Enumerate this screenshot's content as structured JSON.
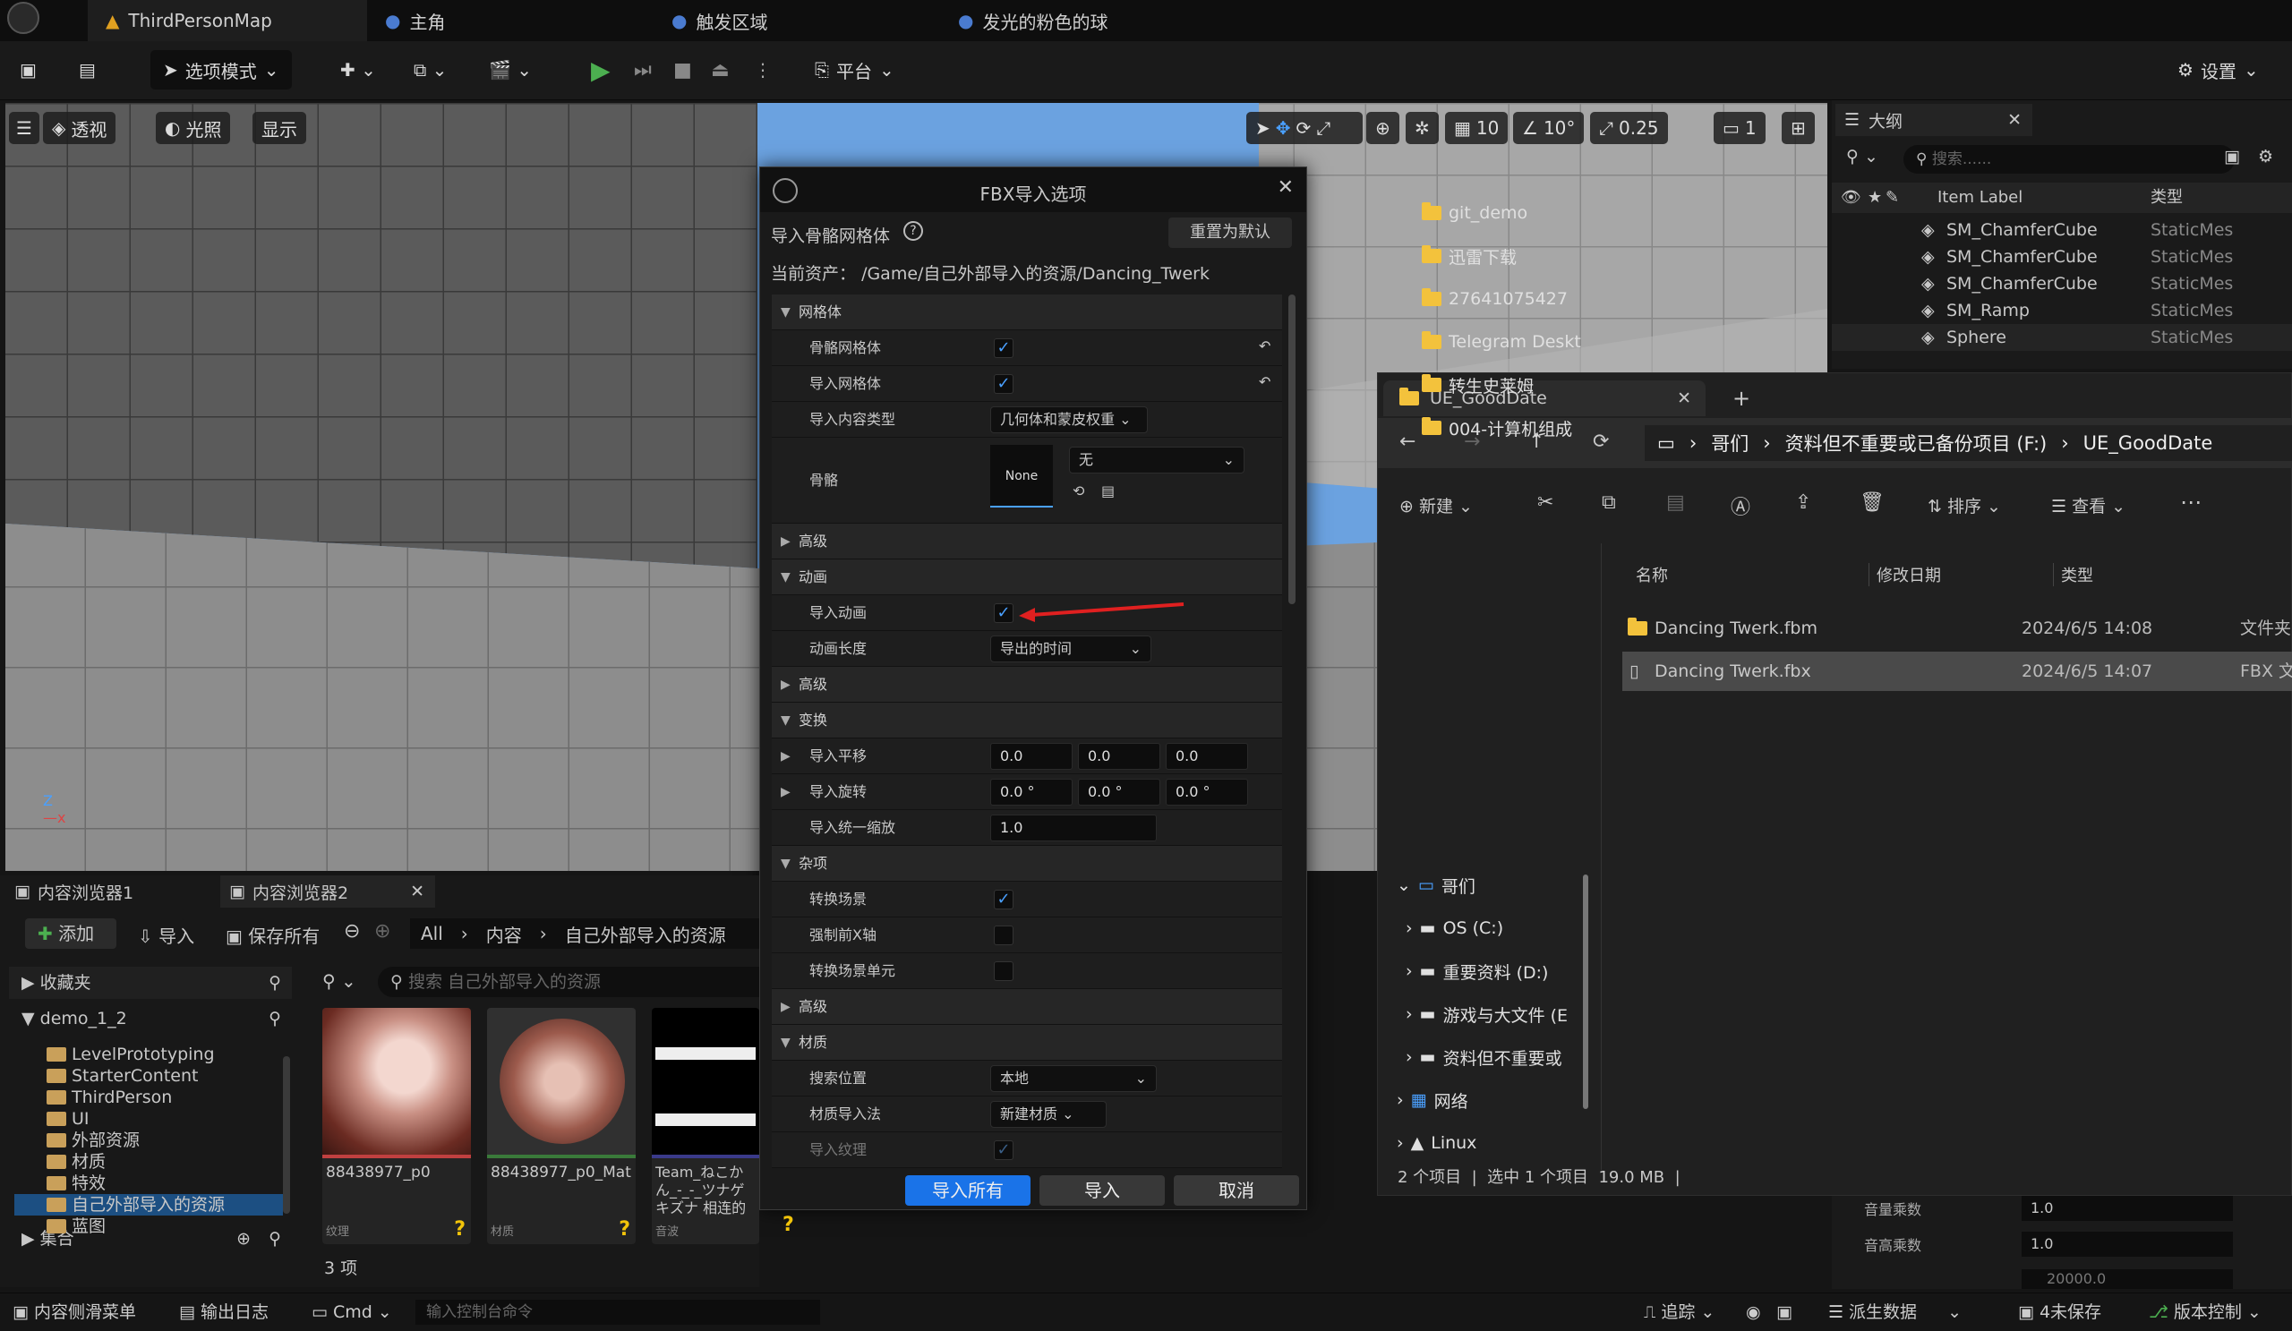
{
  "tabs": {
    "map": "ThirdPersonMap",
    "t1": "主角",
    "t2": "触发区域",
    "t3": "发光的粉色的球"
  },
  "toolbar": {
    "mode": "选项模式",
    "platform": "平台",
    "settings": "设置"
  },
  "viewport": {
    "perspective": "透视",
    "lighting": "光照",
    "show": "显示",
    "grid": "10",
    "angle": "10°",
    "scale": "0.25",
    "cam": "1"
  },
  "outliner": {
    "title": "大纲",
    "search_placeholder": "搜索......",
    "col_label": "Item Label",
    "col_type": "类型",
    "items": [
      {
        "name": "SM_ChamferCube",
        "type": "StaticMes"
      },
      {
        "name": "SM_ChamferCube",
        "type": "StaticMes"
      },
      {
        "name": "SM_ChamferCube",
        "type": "StaticMes"
      },
      {
        "name": "SM_Ramp",
        "type": "StaticMes"
      },
      {
        "name": "Sphere",
        "type": "StaticMes"
      }
    ]
  },
  "fbx": {
    "title": "FBX导入选项",
    "subtitle": "导入骨骼网格体",
    "reset": "重置为默认",
    "asset_label": "当前资产：",
    "asset_path": "/Game/自己外部导入的资源/Dancing_Twerk",
    "sec_mesh": "网格体",
    "skeletal_mesh": "骨骼网格体",
    "import_mesh": "导入网格体",
    "content_type": "导入内容类型",
    "content_type_val": "几何体和蒙皮权重",
    "skeleton": "骨骼",
    "skeleton_thumb": "None",
    "skeleton_val": "无",
    "advanced": "高级",
    "sec_anim": "动画",
    "import_anim": "导入动画",
    "anim_length": "动画长度",
    "anim_length_val": "导出的时间",
    "sec_transform": "变换",
    "import_translation": "导入平移",
    "translation": [
      "0.0",
      "0.0",
      "0.0"
    ],
    "import_rotation": "导入旋转",
    "rotation": [
      "0.0 °",
      "0.0 °",
      "0.0 °"
    ],
    "import_uniform_scale": "导入统一缩放",
    "scale_val": "1.0",
    "sec_misc": "杂项",
    "convert_scene": "转换场景",
    "force_front_x": "强制前X轴",
    "convert_scene_unit": "转换场景单元",
    "sec_material": "材质",
    "search_location": "搜索位置",
    "search_location_val": "本地",
    "material_import": "材质导入法",
    "material_import_val": "新建材质",
    "import_textures": "导入纹理",
    "btn_import_all": "导入所有",
    "btn_import": "导入",
    "btn_cancel": "取消"
  },
  "explorer": {
    "tab_title": "UE_GoodDate",
    "breadcrumb": [
      "哥们",
      "资料但不重要或已备份项目 (F:)",
      "UE_GoodDate"
    ],
    "new": "新建",
    "sort": "排序",
    "view": "查看",
    "col_name": "名称",
    "col_date": "修改日期",
    "col_type": "类型",
    "files": [
      {
        "name": "Dancing Twerk.fbm",
        "date": "2024/6/5 14:08",
        "type": "文件夹"
      },
      {
        "name": "Dancing Twerk.fbx",
        "date": "2024/6/5 14:07",
        "type": "FBX 文"
      }
    ],
    "quick": [
      "git_demo",
      "迅雷下载",
      "27641075427",
      "Telegram Deskt",
      "转生史莱姆",
      "004-计算机组成"
    ],
    "pc": "哥们",
    "drives": [
      "OS (C:)",
      "重要资料 (D:)",
      "游戏与大文件 (E",
      "资料但不重要或"
    ],
    "network": "网络",
    "linux": "Linux",
    "status": "2 个项目  |  选中 1 个项目  19.0 MB  |"
  },
  "content_browser": {
    "tab1": "内容浏览器1",
    "tab2": "内容浏览器2",
    "add": "添加",
    "import": "导入",
    "save_all": "保存所有",
    "path": [
      "All",
      "内容",
      "自己外部导入的资源"
    ],
    "favorites": "收藏夹",
    "project": "demo_1_2",
    "search_placeholder": "搜索 自己外部导入的资源",
    "tree": [
      "LevelPrototyping",
      "StarterContent",
      "ThirdPerson",
      "UI",
      "外部资源",
      "材质",
      "特效",
      "自己外部导入的资源",
      "蓝图"
    ],
    "collections": "集合",
    "count": "3 项",
    "assets": [
      {
        "name": "88438977_p0",
        "kind": "纹理"
      },
      {
        "name": "88438977_p0_Mat",
        "kind": "材质"
      },
      {
        "name": "Team_ねこかん_-_-_ツナゲキズナ 相连的羁绊_",
        "kind": "音波"
      }
    ]
  },
  "details": {
    "volume": "音量乘数",
    "volume_val": "1.0",
    "pitch": "音高乘数",
    "pitch_val": "1.0",
    "extra_val": "20000.0"
  },
  "statusbar": {
    "drawer": "内容侧滑菜单",
    "log": "输出日志",
    "cmd": "Cmd",
    "cmd_placeholder": "输入控制台命令",
    "trace": "追踪",
    "derived": "派生数据",
    "unsaved": "4未保存",
    "source": "版本控制"
  }
}
